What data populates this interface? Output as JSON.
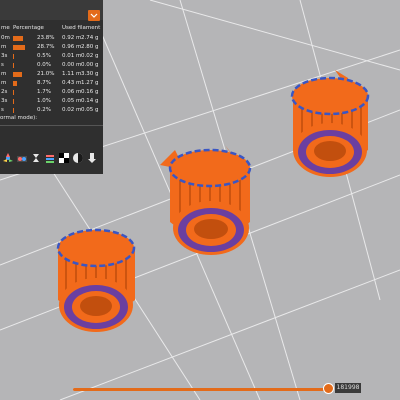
{
  "legend": {
    "headers": {
      "name": "me",
      "percentage": "Percentage",
      "used_filament": "Used filament"
    },
    "rows": [
      {
        "name": "0m",
        "percent": "23.8%",
        "fraction": 0.238,
        "length": "0.92 m",
        "weight": "2.74 g"
      },
      {
        "name": "m",
        "percent": "28.7%",
        "fraction": 0.287,
        "length": "0.96 m",
        "weight": "2.80 g"
      },
      {
        "name": "3s",
        "percent": "0.5%",
        "fraction": 0.005,
        "length": "0.01 m",
        "weight": "0.02 g"
      },
      {
        "name": "s",
        "percent": "0.0%",
        "fraction": 0.0,
        "length": "0.00 m",
        "weight": "0.00 g"
      },
      {
        "name": "m",
        "percent": "21.0%",
        "fraction": 0.21,
        "length": "1.11 m",
        "weight": "3.30 g"
      },
      {
        "name": "m",
        "percent": "8.7%",
        "fraction": 0.087,
        "length": "0.43 m",
        "weight": "1.27 g"
      },
      {
        "name": "2s",
        "percent": "1.7%",
        "fraction": 0.017,
        "length": "0.06 m",
        "weight": "0.16 g"
      },
      {
        "name": "3s",
        "percent": "1.0%",
        "fraction": 0.01,
        "length": "0.05 m",
        "weight": "0.14 g"
      },
      {
        "name": "s",
        "percent": "0.2%",
        "fraction": 0.002,
        "length": "0.02 m",
        "weight": "0.05 g"
      }
    ],
    "footer": "ormal mode):",
    "accent": "#e36b1a"
  },
  "toolbar_icons": [
    "fan-icon",
    "speed-icon",
    "time-icon",
    "layer-icon",
    "checker-icon",
    "color-icon",
    "export-icon"
  ],
  "layer_slider": {
    "value": "181998",
    "position": 0.99
  },
  "colors": {
    "bed": "#b5b5b7",
    "part": "#f26a1b",
    "part_dark": "#c24f0e",
    "infill": "#6b3fa0",
    "support": "#3a56c4"
  }
}
